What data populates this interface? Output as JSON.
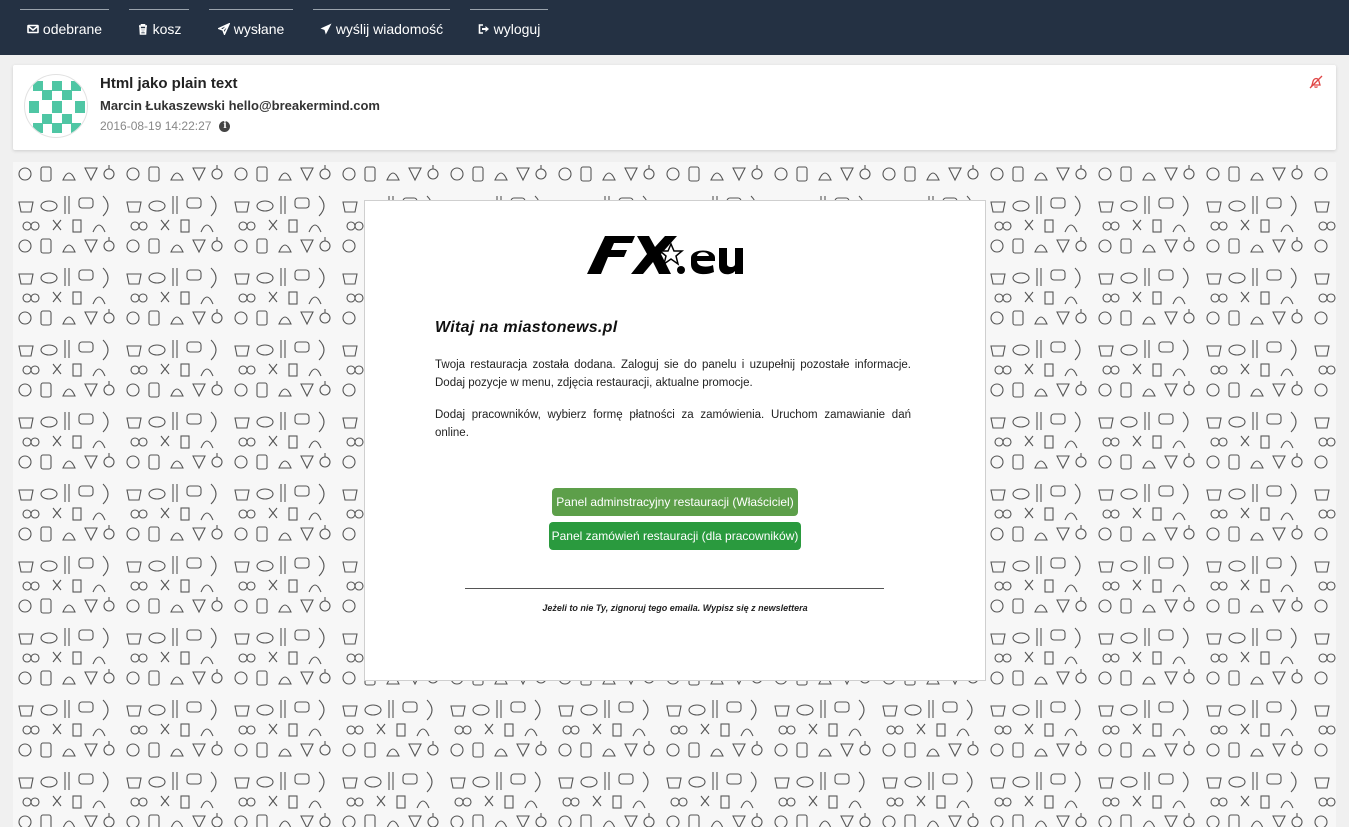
{
  "nav": [
    {
      "label": "odebrane",
      "icon": "envelope-icon"
    },
    {
      "label": "kosz",
      "icon": "trash-icon"
    },
    {
      "label": "wysłane",
      "icon": "paper-plane-outline-icon"
    },
    {
      "label": "wyślij wiadomość",
      "icon": "paper-plane-icon"
    },
    {
      "label": "wyloguj",
      "icon": "sign-out-icon"
    }
  ],
  "message": {
    "subject": "Html jako plain text",
    "sender": "Marcin Łukaszewski hello@breakermind.com",
    "date": "2016-08-19 14:22:27"
  },
  "email": {
    "logo_text": "FX.eu",
    "welcome": "Witaj na miastonews.pl",
    "paragraph1": "Twoja restauracja została dodana. Zaloguj sie do panelu i uzupełnij pozostałe informacje. Dodaj pozycje w menu, zdjęcia restauracji, aktualne promocje.",
    "paragraph2": "Dodaj pracowników, wybierz formę płatności za zamówienia. Uruchom zamawianie dań online.",
    "button_owner": "Panel adminstracyjny restauracji (Właściciel)",
    "button_staff": "Panel zamówień restauracji (dla pracowników)",
    "footer": "Jeżeli to nie Ty, zignoruj tego emaila. Wypisz się z newslettera"
  },
  "colors": {
    "topbar": "#243143",
    "button_owner": "#5d9f4a",
    "button_staff": "#2a9a3e",
    "avatar_pattern": "#4fc6a4",
    "mute_icon": "#e04646"
  }
}
